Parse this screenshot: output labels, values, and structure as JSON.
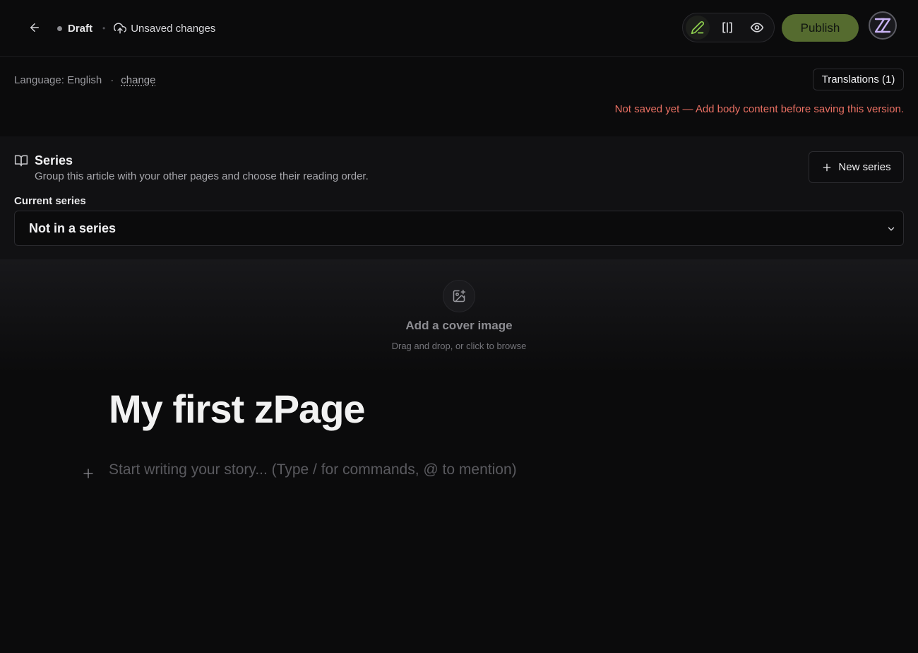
{
  "header": {
    "back_icon": "arrow-left-icon",
    "status": "Draft",
    "save_state": "Unsaved changes",
    "save_icon": "cloud-upload-icon",
    "modes": [
      {
        "name": "edit",
        "icon": "pencil-icon",
        "active": true
      },
      {
        "name": "split",
        "icon": "split-view-icon",
        "active": false
      },
      {
        "name": "preview",
        "icon": "eye-icon",
        "active": false
      }
    ],
    "publish_label": "Publish",
    "avatar_text": "Z"
  },
  "language": {
    "label": "Language: English",
    "separator": "·",
    "change_label": "change",
    "translations_label": "Translations (1)"
  },
  "warning": "Not saved yet — Add body content before saving this version.",
  "series": {
    "icon": "book-open-icon",
    "title": "Series",
    "description": "Group this article with your other pages and choose their reading order.",
    "new_series_label": "New series",
    "current_label": "Current series",
    "current_value": "Not in a series"
  },
  "cover": {
    "icon": "image-plus-icon",
    "title": "Add a cover image",
    "subtitle": "Drag and drop, or click to browse"
  },
  "editor": {
    "title": "My first zPage",
    "placeholder": "Start writing your story... (Type / for commands, @ to mention)"
  },
  "colors": {
    "background": "#0b0b0c",
    "publish": "#556b2f",
    "warning": "#e86f62",
    "active_mode": "#8fd14f"
  }
}
